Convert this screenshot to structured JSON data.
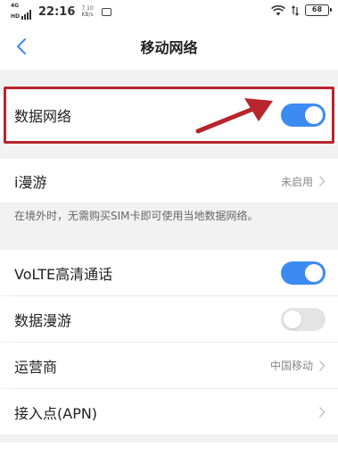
{
  "status_bar": {
    "network": "4G",
    "network_sub": "HD",
    "time": "22:16",
    "speed_value": "7.10",
    "speed_unit": "KB/s",
    "battery": "68"
  },
  "header": {
    "title": "移动网络"
  },
  "rows": {
    "mobile_data": {
      "label": "数据网络",
      "toggle_on": true
    },
    "iroaming": {
      "label": "i漫游",
      "value": "未启用"
    },
    "volte": {
      "label": "VoLTE高清通话",
      "toggle_on": true
    },
    "data_roaming": {
      "label": "数据漫游",
      "toggle_on": false
    },
    "carrier": {
      "label": "运营商",
      "value": "中国移动"
    },
    "apn": {
      "label": "接入点(APN)"
    }
  },
  "hint": "在境外时，无需购买SIM卡即可使用当地数据网络。",
  "colors": {
    "accent": "#3c8bf0",
    "highlight": "#b8252c"
  }
}
